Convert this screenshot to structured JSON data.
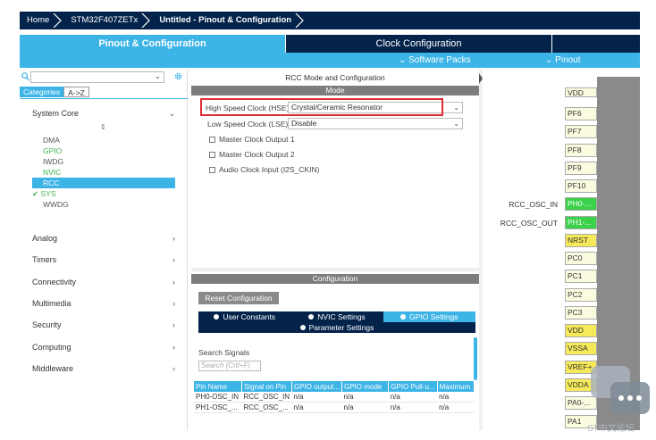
{
  "breadcrumb": [
    "Home",
    "STM32F407ZETx",
    "Untitled - Pinout & Configuration"
  ],
  "tabs": {
    "pinout": "Pinout & Configuration",
    "clock": "Clock Configuration"
  },
  "subbar": {
    "software_packs": "Software Packs",
    "pinout": "Pinout"
  },
  "left": {
    "categories_tab": "Categories",
    "az_tab": "A->Z",
    "system_core": "System Core",
    "system_core_items": [
      "DMA",
      "GPIO",
      "IWDG",
      "NVIC",
      "RCC",
      "SYS",
      "WWDG"
    ],
    "groups": [
      "Analog",
      "Timers",
      "Connectivity",
      "Multimedia",
      "Security",
      "Computing",
      "Middleware"
    ]
  },
  "mid": {
    "title": "RCC Mode and Configuration",
    "mode_bar": "Mode",
    "hse_label": "High Speed Clock (HSE)",
    "hse_value": "Crystal/Ceramic Resonator",
    "lse_label": "Low Speed Clock (LSE)",
    "lse_value": "Disable",
    "checkboxes": [
      "Master Clock Output 1",
      "Master Clock Output 2",
      "Audio Clock Input (I2S_CKIN)"
    ],
    "config_bar": "Configuration",
    "reset_button": "Reset Configuration",
    "cfg_tabs": [
      "User Constants",
      "NVIC Settings",
      "GPIO Settings"
    ],
    "param_tab": "Parameter Settings",
    "search_signals": "Search Signals",
    "search_placeholder": "Search (Crtl+F)",
    "table_headers": [
      "Pin Name",
      "Signal on Pin",
      "GPIO output...",
      "GPIO mode",
      "GPIO Pull-u...",
      "Maximum"
    ],
    "table_rows": [
      [
        "PH0-OSC_IN",
        "RCC_OSC_IN",
        "n/a",
        "n/a",
        "n/a",
        "n/a"
      ],
      [
        "PH1-OSC_...",
        "RCC_OSC_...",
        "n/a",
        "n/a",
        "n/a",
        "n/a"
      ]
    ]
  },
  "chip": {
    "pins": [
      "VDD",
      "PF6",
      "PF7",
      "PF8",
      "PF9",
      "PF10",
      "PH0-...",
      "PH1-...",
      "NRST",
      "PC0",
      "PC1",
      "PC2",
      "PC3",
      "VDD",
      "VSSA",
      "VREF+",
      "VDDA",
      "PA0-...",
      "PA1"
    ],
    "labels": {
      "ph0": "RCC_OSC_IN",
      "ph1": "RCC_OSC_OUT"
    }
  },
  "watermark": "ST中文论坛",
  "colors": {
    "navy": "#03234b",
    "accent": "#3cb4e6",
    "highlight": "#e12b35",
    "green_pin": "#3bd24a"
  }
}
